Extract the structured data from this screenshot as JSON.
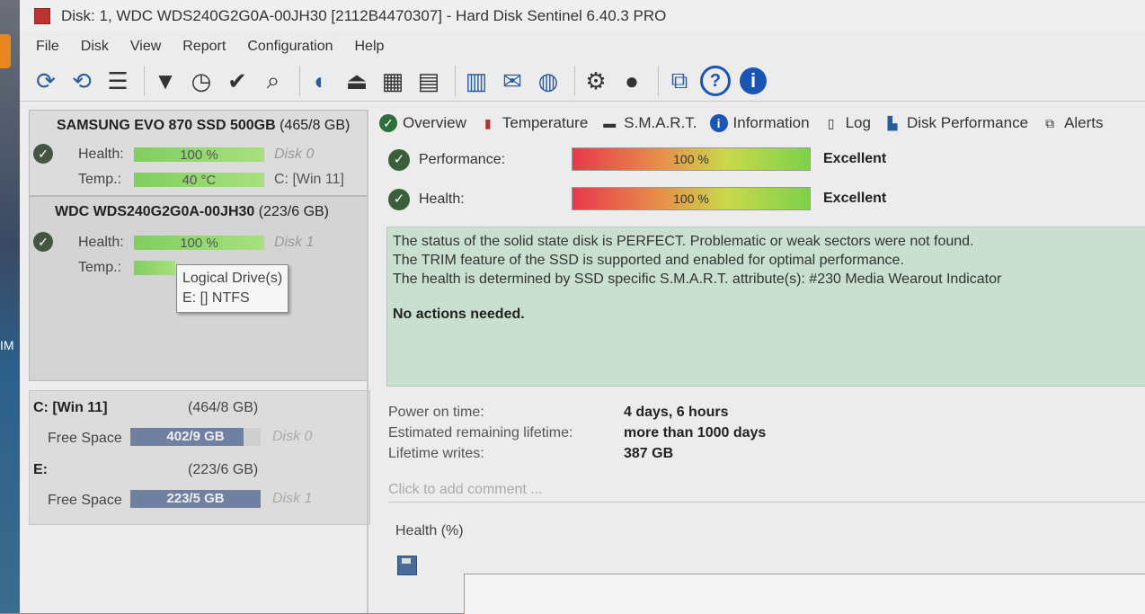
{
  "window": {
    "title": "Disk: 1, WDC WDS240G2G0A-00JH30 [2112B4470307]  -  Hard Disk Sentinel 6.40.3 PRO"
  },
  "menu": [
    "File",
    "Disk",
    "View",
    "Report",
    "Configuration",
    "Help"
  ],
  "toolbar": {
    "icons": [
      "refresh-icon",
      "refresh-alert-icon",
      "disk-list-icon",
      "disk-test-icon",
      "disk-test-clock-icon",
      "disk-test-check-icon",
      "disk-test-search-icon",
      "surface-icon",
      "eject-icon",
      "disk-tools-icon",
      "disk-export-icon",
      "report-icon",
      "mail-icon",
      "globe-icon",
      "settings-icon",
      "tools-icon",
      "screenshot-icon",
      "help-icon",
      "info-icon"
    ]
  },
  "disks": [
    {
      "name": "SAMSUNG EVO 870 SSD 500GB",
      "capacity": "(465/8 GB)",
      "health_label": "Health:",
      "health_value": "100 %",
      "health_pct": 100,
      "disk_label": "Disk 0",
      "temp_label": "Temp.:",
      "temp_value": "40 °C",
      "volume": "C: [Win 11]"
    },
    {
      "name": "WDC WDS240G2G0A-00JH30",
      "capacity": "(223/6 GB)",
      "health_label": "Health:",
      "health_value": "100 %",
      "health_pct": 100,
      "disk_label": "Disk 1",
      "temp_label": "Temp.:"
    }
  ],
  "tooltip": {
    "title": "Logical Drive(s)",
    "line": "E: [] NTFS"
  },
  "volumes": [
    {
      "name": "C: [Win 11]",
      "size": "(464/8 GB)",
      "free_label": "Free Space",
      "free_value": "402/9 GB",
      "free_pct": 87,
      "disk": "Disk 0"
    },
    {
      "name": "E:",
      "size": "(223/6 GB)",
      "free_label": "Free Space",
      "free_value": "223/5 GB",
      "free_pct": 100,
      "disk": "Disk 1"
    }
  ],
  "tabs": [
    "Overview",
    "Temperature",
    "S.M.A.R.T.",
    "Information",
    "Log",
    "Disk Performance",
    "Alerts"
  ],
  "performance": {
    "label": "Performance:",
    "value": "100 %",
    "pct": 100,
    "rating": "Excellent"
  },
  "health": {
    "label": "Health:",
    "value": "100 %",
    "pct": 100,
    "rating": "Excellent"
  },
  "status": {
    "lines": [
      "The status of the solid state disk is PERFECT. Problematic or weak sectors were not found.",
      "The TRIM feature of the SSD is supported and enabled for optimal performance.",
      "The health is determined by SSD specific S.M.A.R.T. attribute(s):  #230 Media Wearout Indicator"
    ],
    "action": "No actions needed."
  },
  "info": {
    "power_on_label": "Power on time:",
    "power_on_value": "4 days, 6 hours",
    "lifetime_label": "Estimated remaining lifetime:",
    "lifetime_value": "more than 1000 days",
    "writes_label": "Lifetime writes:",
    "writes_value": "387 GB"
  },
  "comment_placeholder": "Click to add comment ...",
  "health_chart_label": "Health (%)",
  "colors": {
    "accent": "#1a55b5",
    "status_bg": "#c9dfd0",
    "health_bar": "#7fcf5f"
  }
}
